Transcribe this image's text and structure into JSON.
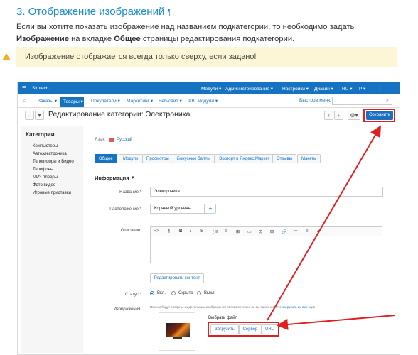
{
  "doc": {
    "heading": "3. Отображение изображений",
    "heading_mark": "¶",
    "para_pre": "Если вы хотите показать изображение над названием подкатегории, то необходимо задать",
    "para_b1": "Изображение",
    "para_mid": "на вкладке",
    "para_b2": "Общее",
    "para_post": "страницы редактирования подкатегории.",
    "warning": "Изображение отображается всегда только сверху, если задано!"
  },
  "admin": {
    "brand": "Simtech",
    "top_menu": [
      "Модули ▾",
      "Администрирование ▾",
      "Настройки ▾",
      "Дизайн ▾",
      "RU ▾",
      "Р ▾"
    ],
    "nav": [
      "Заказы ▾",
      "Товары ▾",
      "Покупатели ▾",
      "Маркетинг ▾",
      "Веб-сайт ▾",
      "AB: Модули ▾"
    ],
    "quick_menu": "Быстрое меню",
    "page_title": "Редактирование категории: Электроника",
    "save_label": "Сохранить",
    "sidebar": {
      "title": "Категории",
      "items": [
        "Компьютеры",
        "Автоэлектроника",
        "Телевизоры и Видео",
        "Телефоны",
        "MP3 плееры",
        "Фото видео",
        "Игровые приставки"
      ]
    },
    "lang_label": "Язык:",
    "lang_value": "Русский",
    "tabs": [
      "Общее",
      "Модули",
      "Просмотры",
      "Бонусные баллы",
      "Экспорт в Яндекс.Маркет",
      "Отзывы",
      "Макеты"
    ],
    "section_title": "Информация",
    "name_label": "Название:",
    "name_value": "Электроника",
    "location_label": "Расположение:",
    "location_value": "Корневой уровень",
    "desc_label": "Описание:",
    "editor_tools": [
      "<>",
      "¶",
      "B",
      "I",
      "S",
      "⋮≡",
      "≡",
      "⊞",
      "▭",
      "⊡",
      "⊞",
      "🔗",
      "═",
      "≡",
      "▲"
    ],
    "edit_content": "Редактировать контент",
    "status_label": "Статус:",
    "status_options": [
      "Вкл.",
      "Скрыто",
      "Выкл"
    ],
    "images_label": "Изображения:",
    "images_note": "Иконки будут созданы из детальных изображений автоматически, но вы также можете",
    "images_note_link": "загрузить их вручную",
    "choose_file": "Выбрать файл",
    "upload_buttons": [
      "Загрузить",
      "Сервер",
      "URL"
    ]
  },
  "colors": {
    "accent": "#1573c2",
    "highlight": "#e02020",
    "warning_bg": "#fdf6d6"
  }
}
